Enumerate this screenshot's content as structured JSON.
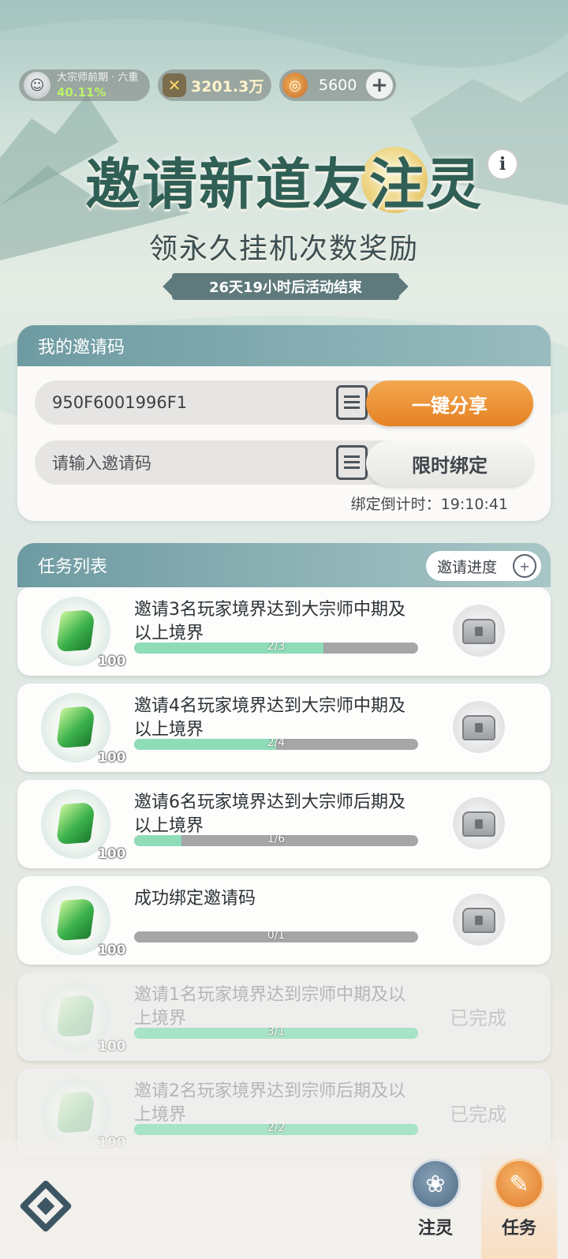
{
  "header": {
    "rank_title": "大宗师前期 · 六重",
    "rank_percent": "40.11%",
    "power_value": "3201.3万",
    "coin_value": "5600",
    "plus_icon": "plus-icon"
  },
  "hero": {
    "title": "邀请新道友注灵",
    "subtitle": "领永久挂机次数奖励",
    "countdown_banner": "26天19小时后活动结束",
    "info_icon": "i"
  },
  "invite": {
    "section_title": "我的邀请码",
    "my_code": "950F6001996F1",
    "input_placeholder": "请输入邀请码",
    "share_label": "一键分享",
    "bind_label": "限时绑定",
    "bind_countdown": "绑定倒计时：19:10:41"
  },
  "tasks": {
    "section_title": "任务列表",
    "progress_label": "邀请进度",
    "items": [
      {
        "text": "邀请3名玩家境界达到大宗师中期及以上境界",
        "qty": "100",
        "progress": "2/3",
        "fraction": 0.667,
        "status": "pending"
      },
      {
        "text": "邀请4名玩家境界达到大宗师中期及以上境界",
        "qty": "100",
        "progress": "2/4",
        "fraction": 0.5,
        "status": "pending"
      },
      {
        "text": "邀请6名玩家境界达到大宗师后期及以上境界",
        "qty": "100",
        "progress": "1/6",
        "fraction": 0.167,
        "status": "pending"
      },
      {
        "text": "成功绑定邀请码",
        "qty": "100",
        "progress": "0/1",
        "fraction": 0,
        "status": "pending"
      },
      {
        "text": "邀请1名玩家境界达到宗师中期及以上境界",
        "qty": "100",
        "progress": "3/1",
        "fraction": 1,
        "status": "已完成"
      },
      {
        "text": "邀请2名玩家境界达到宗师后期及以上境界",
        "qty": "100",
        "progress": "2/2",
        "fraction": 1,
        "status": "已完成"
      }
    ]
  },
  "nav": {
    "zhuling": "注灵",
    "task": "任务"
  },
  "colors": {
    "accent_orange": "#e58224",
    "progress_green": "#8fdcb8",
    "header_teal": "#6e9ba2"
  }
}
